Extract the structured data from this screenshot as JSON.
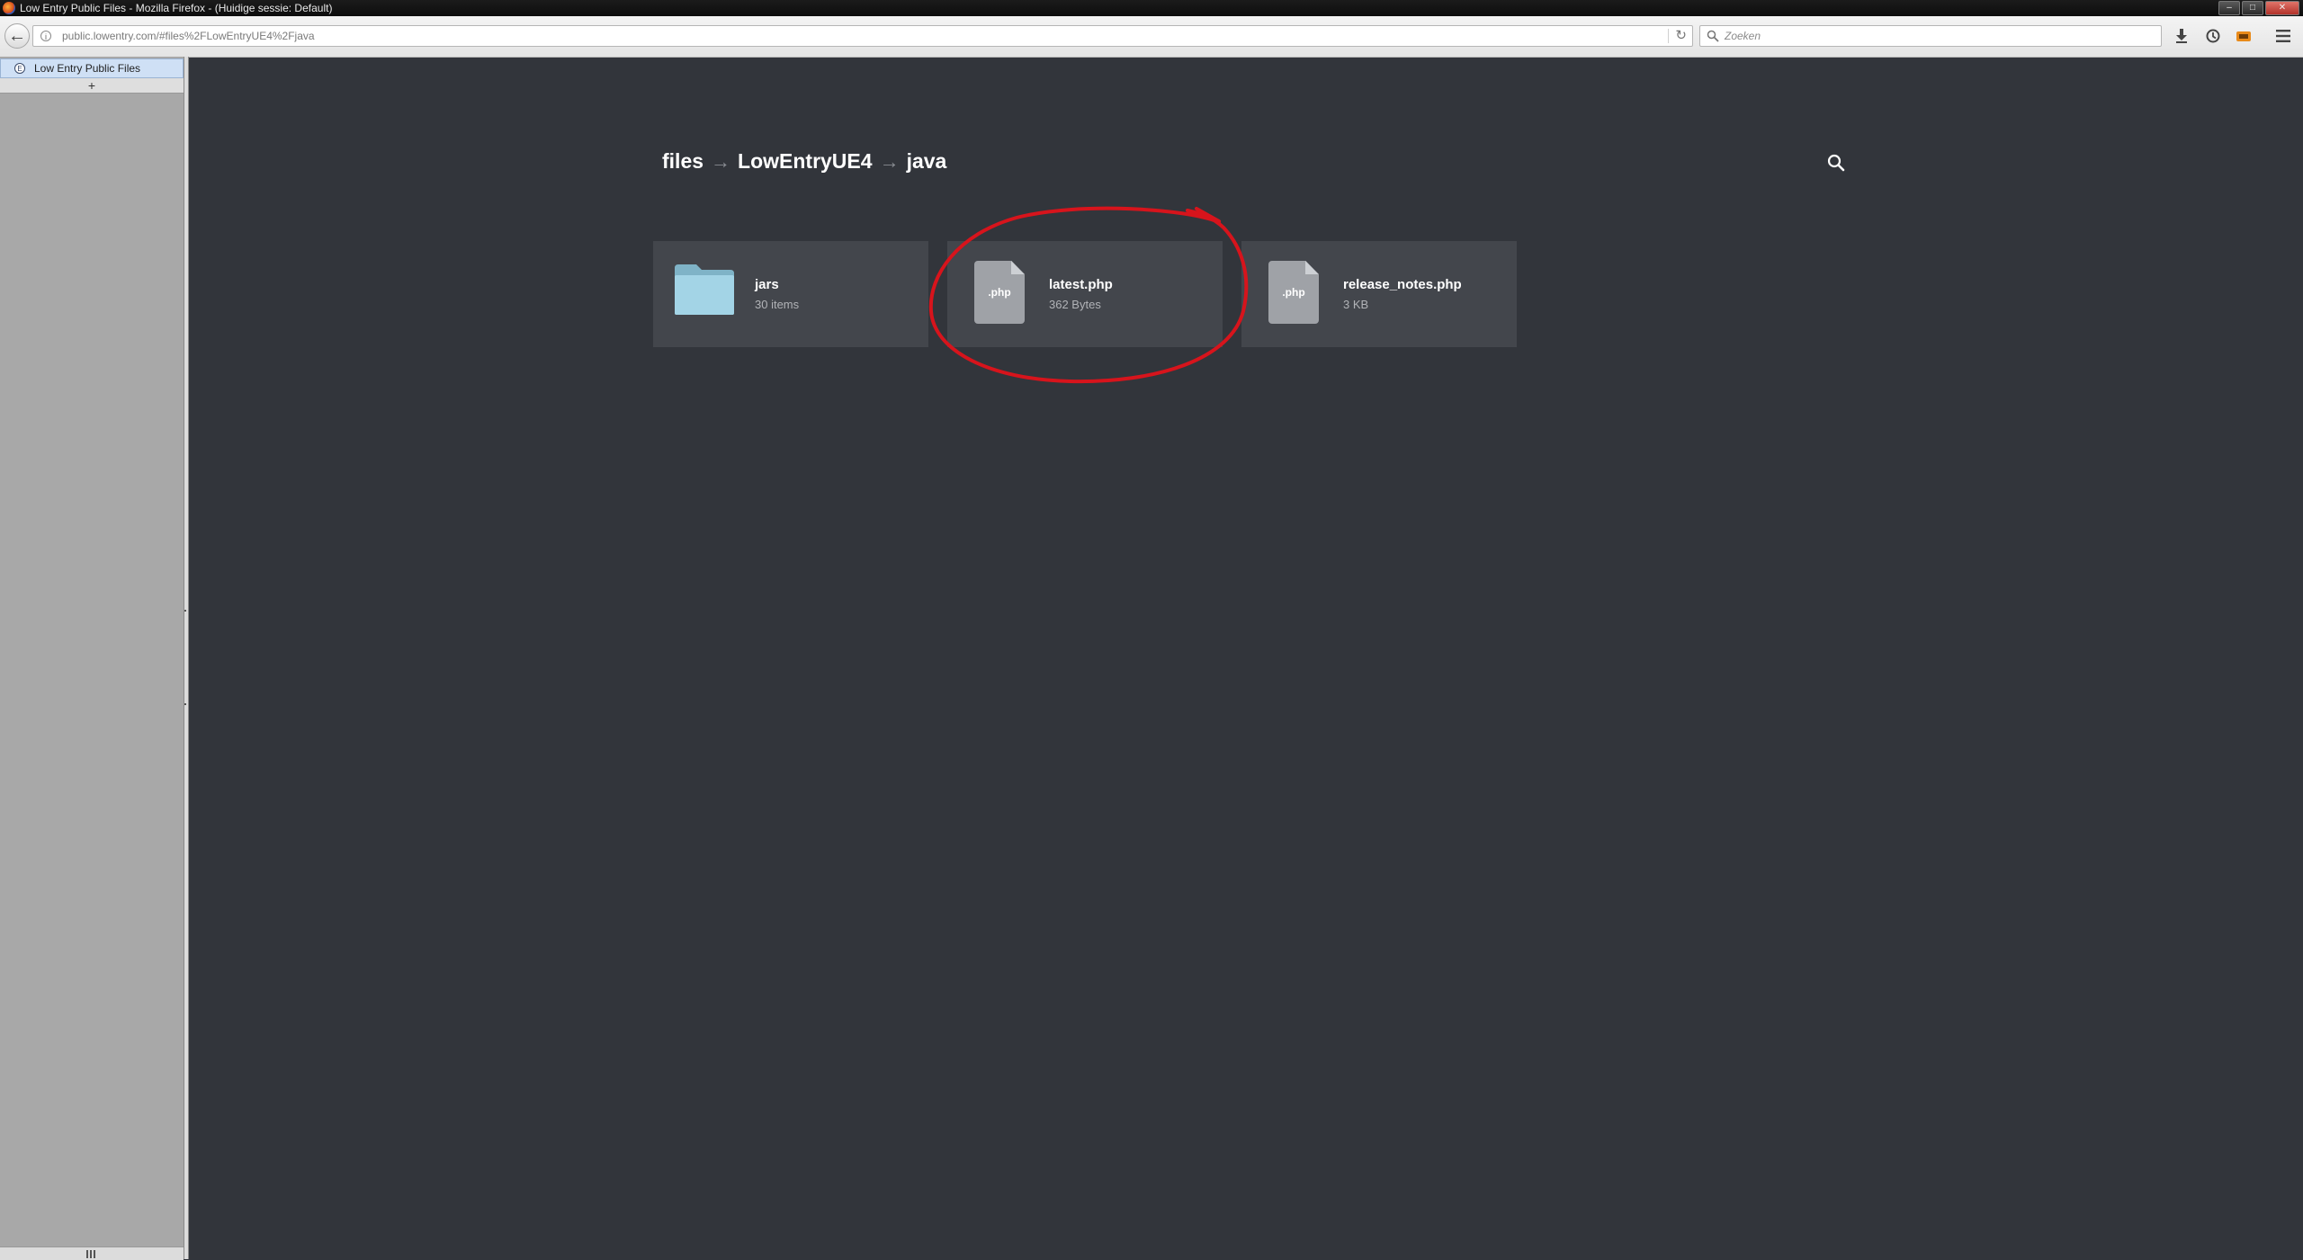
{
  "window": {
    "title": "Low Entry Public Files - Mozilla Firefox - (Huidige sessie: Default)",
    "buttons": {
      "minimize": "–",
      "maximize": "□",
      "close": "✕"
    }
  },
  "navbar": {
    "back_glyph": "←",
    "url": "public.lowentry.com/#files%2FLowEntryUE4%2Fjava",
    "reload_glyph": "↻",
    "search_placeholder": "Zoeken",
    "icons": {
      "download": "download-icon",
      "history": "history-icon",
      "extension": "extension-icon",
      "menu": "hamburger-menu-icon"
    }
  },
  "sidebar": {
    "tabs": [
      {
        "label": "Low Entry Public Files",
        "favicon": "low-entry-favicon"
      }
    ],
    "new_tab_glyph": "+"
  },
  "page": {
    "breadcrumb": [
      "files",
      "LowEntryUE4",
      "java"
    ],
    "arrow_glyph": "→",
    "items": [
      {
        "type": "folder",
        "name": "jars",
        "meta": "30 items",
        "icon": "folder-icon"
      },
      {
        "type": "file",
        "name": "latest.php",
        "meta": "362 Bytes",
        "ext": ".php",
        "icon": "php-file-icon"
      },
      {
        "type": "file",
        "name": "release_notes.php",
        "meta": "3 KB",
        "ext": ".php",
        "icon": "php-file-icon"
      }
    ],
    "highlight_color": "#d7141c",
    "folder_color": "#a3d4e6"
  }
}
